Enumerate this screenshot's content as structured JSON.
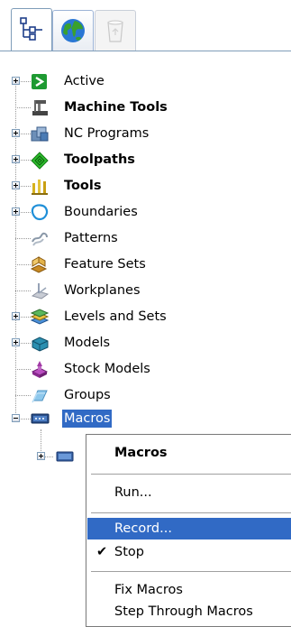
{
  "tabs": [
    {
      "name": "explorer",
      "icon": "tree-icon",
      "active": true
    },
    {
      "name": "globe",
      "icon": "globe-icon",
      "active": false
    },
    {
      "name": "recycle-bin",
      "icon": "recycle-bin-icon",
      "active": false,
      "disabled": true
    }
  ],
  "tree": {
    "items": [
      {
        "label": "Active",
        "icon": "active-arrow-icon",
        "bold": false,
        "expandable": true
      },
      {
        "label": "Machine Tools",
        "icon": "machine-tool-icon",
        "bold": true,
        "expandable": false
      },
      {
        "label": "NC Programs",
        "icon": "nc-programs-icon",
        "bold": false,
        "expandable": true
      },
      {
        "label": "Toolpaths",
        "icon": "toolpaths-icon",
        "bold": true,
        "expandable": true
      },
      {
        "label": "Tools",
        "icon": "tools-icon",
        "bold": true,
        "expandable": true
      },
      {
        "label": "Boundaries",
        "icon": "boundaries-icon",
        "bold": false,
        "expandable": true
      },
      {
        "label": "Patterns",
        "icon": "patterns-icon",
        "bold": false,
        "expandable": false
      },
      {
        "label": "Feature Sets",
        "icon": "feature-sets-icon",
        "bold": false,
        "expandable": false
      },
      {
        "label": "Workplanes",
        "icon": "workplanes-icon",
        "bold": false,
        "expandable": false
      },
      {
        "label": "Levels and Sets",
        "icon": "levels-sets-icon",
        "bold": false,
        "expandable": true
      },
      {
        "label": "Models",
        "icon": "models-icon",
        "bold": false,
        "expandable": true
      },
      {
        "label": "Stock Models",
        "icon": "stock-models-icon",
        "bold": false,
        "expandable": false
      },
      {
        "label": "Groups",
        "icon": "groups-icon",
        "bold": false,
        "expandable": false
      },
      {
        "label": "Macros",
        "icon": "macros-icon",
        "bold": false,
        "expandable": true,
        "expanded": true,
        "selected": true
      }
    ],
    "child": {
      "label": "",
      "icon": "macro-folder-icon",
      "expandable": true
    }
  },
  "context_menu": {
    "title": "Macros",
    "items": [
      {
        "label": "Run...",
        "checked": false,
        "highlighted": false
      },
      {
        "label": "Record...",
        "checked": false,
        "highlighted": true
      },
      {
        "label": "Stop",
        "checked": true,
        "highlighted": false
      },
      {
        "label": "Fix Macros",
        "checked": false,
        "highlighted": false
      },
      {
        "label": "Step Through Macros",
        "checked": false,
        "highlighted": false
      }
    ],
    "check_glyph": "✔"
  },
  "colors": {
    "selection": "#316ac5",
    "tab_border": "#7f9db9",
    "tree_line": "#9a9a9a"
  }
}
